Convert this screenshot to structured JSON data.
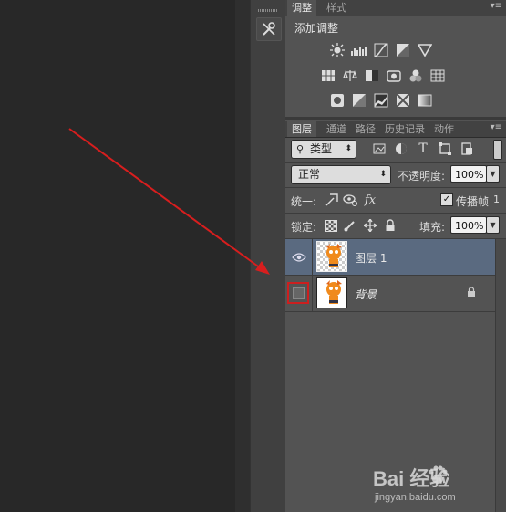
{
  "adjustments_panel": {
    "tabs": [
      {
        "label": "调整"
      },
      {
        "label": "样式"
      }
    ],
    "title": "添加调整",
    "row1_icons": [
      "brightness-contrast-icon",
      "levels-icon",
      "curves-icon",
      "exposure-icon",
      "vibrance-icon"
    ],
    "row2_icons": [
      "hue-saturation-icon",
      "color-balance-icon",
      "black-white-icon",
      "photo-filter-icon",
      "channel-mixer-icon",
      "color-lookup-icon"
    ],
    "row3_icons": [
      "invert-icon",
      "posterize-icon",
      "threshold-icon",
      "selective-color-icon",
      "gradient-map-icon"
    ]
  },
  "layers_panel": {
    "tabs": [
      {
        "label": "图层"
      },
      {
        "label": "通道"
      },
      {
        "label": "路径"
      },
      {
        "label": "历史记录"
      },
      {
        "label": "动作"
      }
    ],
    "filter_kind": "类型",
    "blend_mode": "正常",
    "opacity_label": "不透明度:",
    "opacity_value": "100%",
    "unify_label": "统一:",
    "propagate_label": "传播帧",
    "propagate_value": "1",
    "lock_label": "锁定:",
    "fill_label": "填充:",
    "fill_value": "100%",
    "layers": [
      {
        "name": "图层 1",
        "visible": true,
        "selected": true
      },
      {
        "name": "背景",
        "visible": false,
        "selected": false,
        "locked": true
      }
    ]
  },
  "watermark": {
    "brand": "Bai 经验",
    "url": "jingyan.baidu.com"
  },
  "colors": {
    "selected_row": "#5a6a80",
    "highlight_box": "#cc1f1f",
    "arrow": "#d81e1e"
  }
}
